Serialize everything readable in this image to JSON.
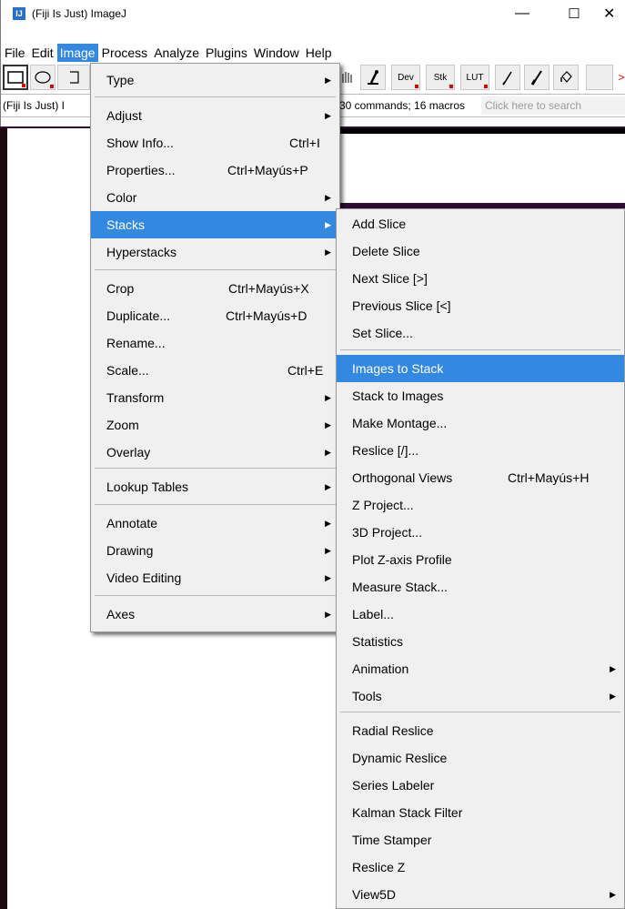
{
  "window": {
    "title": "(Fiji Is Just) ImageJ",
    "icon_label": "IJ",
    "minimize": "—",
    "maximize": "☐",
    "close": "✕"
  },
  "menubar": [
    "File",
    "Edit",
    "Image",
    "Process",
    "Analyze",
    "Plugins",
    "Window",
    "Help"
  ],
  "toolbar": {
    "dev": "Dev",
    "stk": "Stk",
    "lut": "LUT",
    "icons": [
      "rectangle-tool-icon",
      "oval-tool-icon",
      "polygon-tool-icon",
      "hand-tool-icon",
      "magic-wand-icon",
      "pencil-icon",
      "brush-icon",
      "flood-fill-icon"
    ]
  },
  "status": {
    "left": "(Fiji Is Just) I",
    "middle": "30 commands; 16 macros",
    "search_placeholder": "Click here to search"
  },
  "image_menu": {
    "items": [
      {
        "label": "Type",
        "submenu": true
      },
      {
        "label": "Adjust",
        "submenu": true
      },
      {
        "label": "Show Info...",
        "shortcut": "Ctrl+I"
      },
      {
        "label": "Properties...",
        "shortcut": "Ctrl+Mayús+P"
      },
      {
        "label": "Color",
        "submenu": true
      },
      {
        "label": "Stacks",
        "submenu": true,
        "highlighted": true
      },
      {
        "label": "Hyperstacks",
        "submenu": true
      },
      {
        "label": "Crop",
        "shortcut": "Ctrl+Mayús+X"
      },
      {
        "label": "Duplicate...",
        "shortcut": "Ctrl+Mayús+D"
      },
      {
        "label": "Rename..."
      },
      {
        "label": "Scale...",
        "shortcut": "Ctrl+E"
      },
      {
        "label": "Transform",
        "submenu": true
      },
      {
        "label": "Zoom",
        "submenu": true
      },
      {
        "label": "Overlay",
        "submenu": true
      },
      {
        "label": "Lookup Tables",
        "submenu": true
      },
      {
        "label": "Annotate",
        "submenu": true
      },
      {
        "label": "Drawing",
        "submenu": true
      },
      {
        "label": "Video Editing",
        "submenu": true
      },
      {
        "label": "Axes",
        "submenu": true
      }
    ]
  },
  "stacks_menu": {
    "items": [
      {
        "label": "Add Slice"
      },
      {
        "label": "Delete Slice"
      },
      {
        "label": "Next Slice [>]"
      },
      {
        "label": "Previous Slice [<]"
      },
      {
        "label": "Set Slice..."
      },
      {
        "label": "Images to Stack",
        "highlighted": true
      },
      {
        "label": "Stack to Images"
      },
      {
        "label": "Make Montage..."
      },
      {
        "label": "Reslice [/]..."
      },
      {
        "label": "Orthogonal Views",
        "shortcut": "Ctrl+Mayús+H"
      },
      {
        "label": "Z Project..."
      },
      {
        "label": "3D Project..."
      },
      {
        "label": "Plot Z-axis Profile"
      },
      {
        "label": "Measure Stack..."
      },
      {
        "label": "Label..."
      },
      {
        "label": "Statistics"
      },
      {
        "label": "Animation",
        "submenu": true
      },
      {
        "label": "Tools",
        "submenu": true
      },
      {
        "label": "Radial Reslice"
      },
      {
        "label": "Dynamic Reslice"
      },
      {
        "label": "Series Labeler"
      },
      {
        "label": "Kalman Stack Filter"
      },
      {
        "label": "Time Stamper"
      },
      {
        "label": "Reslice Z"
      },
      {
        "label": "View5D",
        "submenu": true
      }
    ]
  },
  "colors": {
    "highlight": "#3388e0",
    "menu_bg": "#f0f0f0"
  }
}
